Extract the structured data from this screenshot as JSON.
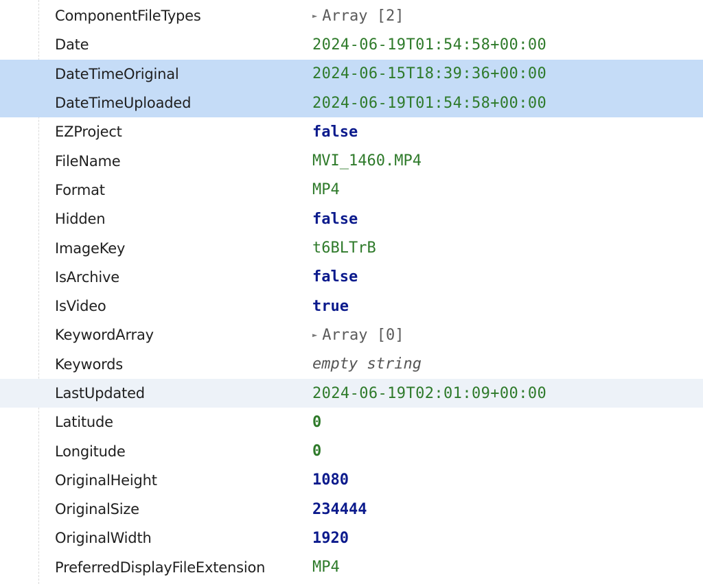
{
  "rows": [
    {
      "key": "ComponentFileTypes",
      "value": "Array [2]",
      "type": "array",
      "expander_icon": "triangle-right-icon"
    },
    {
      "key": "Date",
      "value": "2024-06-19T01:54:58+00:00",
      "type": "date"
    },
    {
      "key": "DateTimeOriginal",
      "value": "2024-06-15T18:39:36+00:00",
      "type": "date",
      "state": "selected"
    },
    {
      "key": "DateTimeUploaded",
      "value": "2024-06-19T01:54:58+00:00",
      "type": "date",
      "state": "selected"
    },
    {
      "key": "EZProject",
      "value": "false",
      "type": "bool"
    },
    {
      "key": "FileName",
      "value": "MVI_1460.MP4",
      "type": "string"
    },
    {
      "key": "Format",
      "value": "MP4",
      "type": "string"
    },
    {
      "key": "Hidden",
      "value": "false",
      "type": "bool"
    },
    {
      "key": "ImageKey",
      "value": "t6BLTrB",
      "type": "string"
    },
    {
      "key": "IsArchive",
      "value": "false",
      "type": "bool"
    },
    {
      "key": "IsVideo",
      "value": "true",
      "type": "bool"
    },
    {
      "key": "KeywordArray",
      "value": "Array [0]",
      "type": "array",
      "expander_icon": "triangle-right-icon"
    },
    {
      "key": "Keywords",
      "value": "empty string",
      "type": "empty"
    },
    {
      "key": "LastUpdated",
      "value": "2024-06-19T02:01:09+00:00",
      "type": "date",
      "state": "hover"
    },
    {
      "key": "Latitude",
      "value": "0",
      "type": "num"
    },
    {
      "key": "Longitude",
      "value": "0",
      "type": "num"
    },
    {
      "key": "OriginalHeight",
      "value": "1080",
      "type": "num big"
    },
    {
      "key": "OriginalSize",
      "value": "234444",
      "type": "num big"
    },
    {
      "key": "OriginalWidth",
      "value": "1920",
      "type": "num big"
    },
    {
      "key": "PreferredDisplayFileExtension",
      "value": "MP4",
      "type": "string"
    }
  ],
  "colors": {
    "key_text": "#1f1f1f",
    "string_value": "#2e7a2a",
    "bool_value": "#0b1a8c",
    "selected_row_bg": "#c5dcf7",
    "hover_row_bg": "#edf2f8"
  }
}
